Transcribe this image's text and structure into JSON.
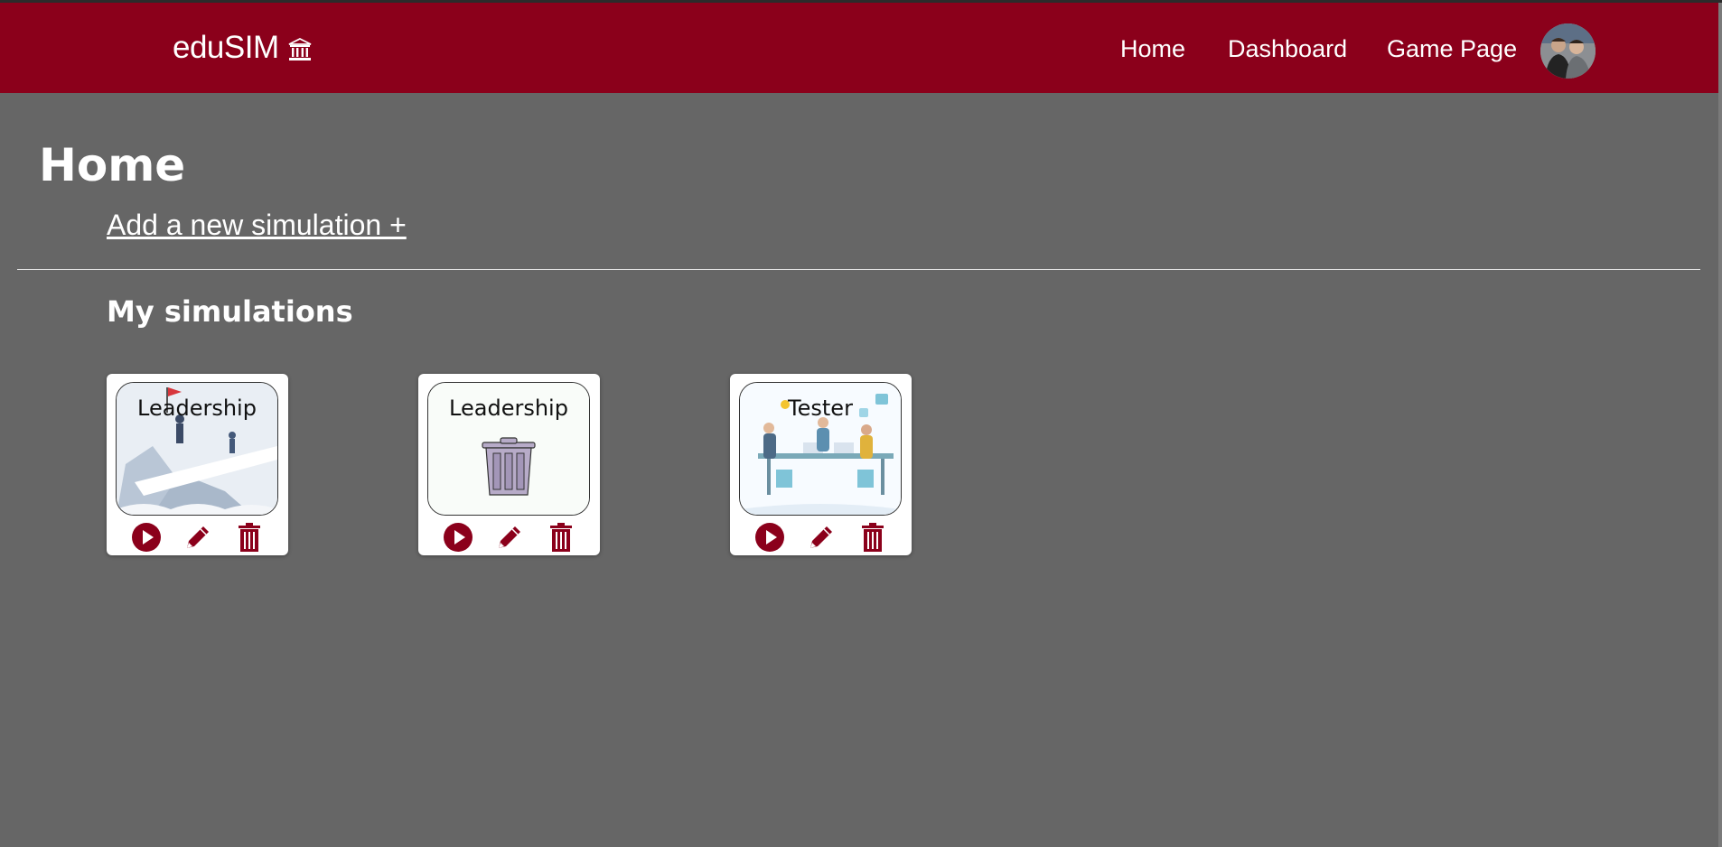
{
  "app": {
    "brand": "eduSIM",
    "brand_icon": "university-icon",
    "accent_color": "#8b001b",
    "background_color": "#666666"
  },
  "nav": {
    "items": [
      {
        "label": "Home"
      },
      {
        "label": "Dashboard"
      },
      {
        "label": "Game Page"
      }
    ],
    "avatar_icon": "user-avatar"
  },
  "main": {
    "title": "Home",
    "add_link": "Add a new simulation +",
    "section_title": "My simulations"
  },
  "simulations": [
    {
      "title": "Leadership",
      "image": "leadership-mountain-illustration",
      "actions": [
        "play-icon",
        "pencil-icon",
        "trash-icon"
      ]
    },
    {
      "title": "Leadership",
      "image": "trash-can-illustration",
      "actions": [
        "play-icon",
        "pencil-icon",
        "trash-icon"
      ]
    },
    {
      "title": "Tester",
      "image": "team-meeting-illustration",
      "actions": [
        "play-icon",
        "pencil-icon",
        "trash-icon"
      ]
    }
  ]
}
